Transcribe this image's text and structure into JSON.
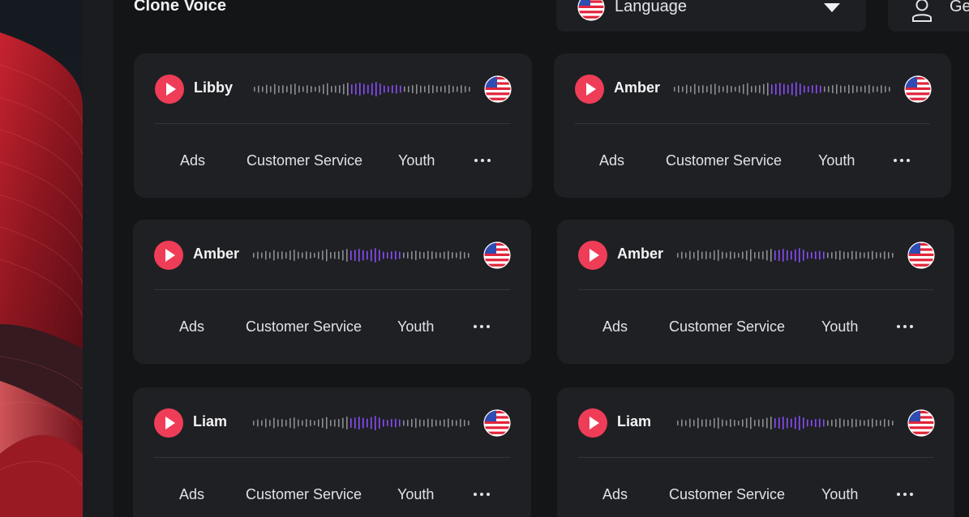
{
  "header": {
    "title": "Clone Voice",
    "language_label": "Language",
    "profile_label": "Ge"
  },
  "colors": {
    "accent_play": "#ef3d58",
    "wave_active": "#8a4dff",
    "wave_idle": "#8d8e93",
    "card_bg": "#1f2023",
    "page_bg": "#141517"
  },
  "voices": [
    {
      "name": "Libby",
      "tags": [
        "Ads",
        "Customer Service",
        "Youth"
      ],
      "flag": "us-flag-icon"
    },
    {
      "name": "Amber",
      "tags": [
        "Ads",
        "Customer Service",
        "Youth"
      ],
      "flag": "us-flag-icon"
    },
    {
      "name": "Amber",
      "tags": [
        "Ads",
        "Customer Service",
        "Youth"
      ],
      "flag": "us-flag-icon"
    },
    {
      "name": "Amber",
      "tags": [
        "Ads",
        "Customer Service",
        "Youth"
      ],
      "flag": "us-flag-icon"
    },
    {
      "name": "Liam",
      "tags": [
        "Ads",
        "Customer Service",
        "Youth"
      ],
      "flag": "us-flag-icon"
    },
    {
      "name": "Liam",
      "tags": [
        "Ads",
        "Customer Service",
        "Youth"
      ],
      "flag": "us-flag-icon"
    }
  ]
}
